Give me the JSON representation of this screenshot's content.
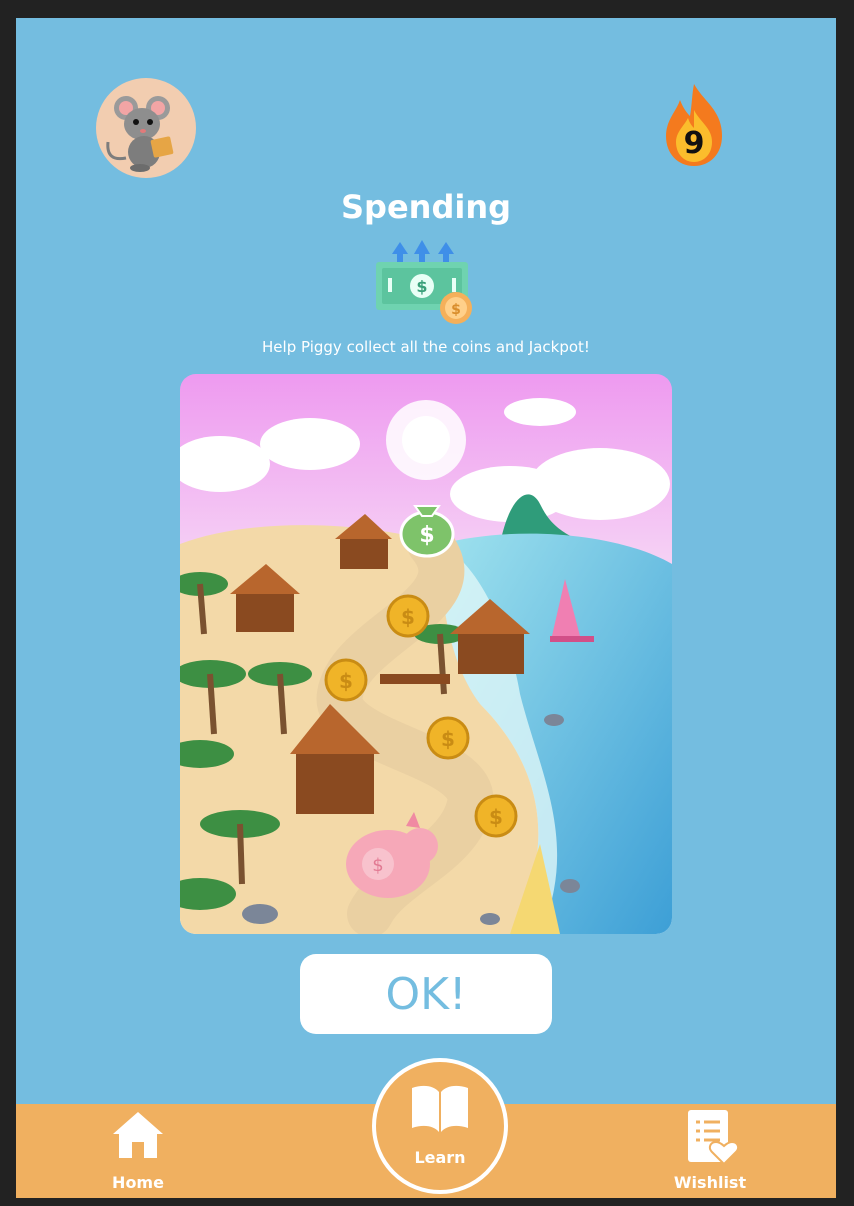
{
  "header": {
    "avatar_alt": "mouse-avatar",
    "streak_count": "9"
  },
  "main": {
    "title": "Spending",
    "subtitle": "Help Piggy collect all the coins and Jackpot!",
    "ok_label": "OK!"
  },
  "nav": {
    "home_label": "Home",
    "learn_label": "Learn",
    "wishlist_label": "Wishlist"
  },
  "colors": {
    "background": "#74bde0",
    "navbar": "#f0b060",
    "button_text": "#74bde0"
  }
}
